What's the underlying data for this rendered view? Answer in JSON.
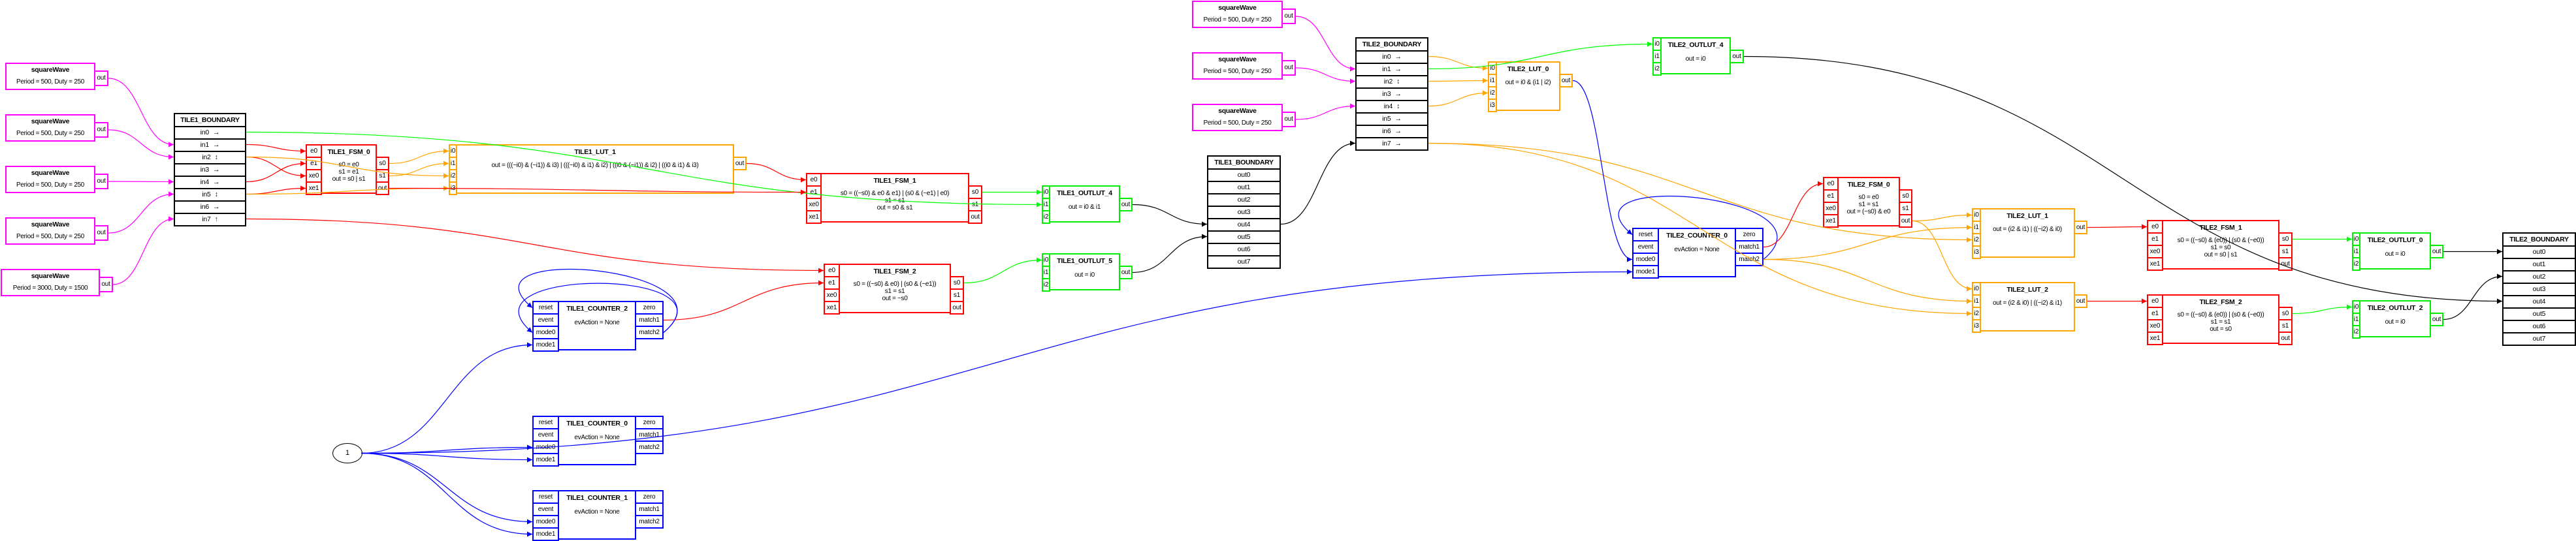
{
  "colors": {
    "source": "#ff00ff",
    "fsm": "#ff0000",
    "lut": "#ffa500",
    "counter": "#0000ff",
    "outlut": "#00ee00",
    "boundary": "#000000",
    "edge_magenta": "#ff00ff",
    "edge_red": "#ff0000",
    "edge_orange": "#ffa500",
    "edge_green": "#00ff00",
    "edge_blue": "#0000ff",
    "edge_black": "#000000"
  },
  "diagram": {
    "sources": [
      {
        "id": "t1w1",
        "title": "squareWave",
        "params": "Period = 500, Duty = 250",
        "port": "out"
      },
      {
        "id": "t1w2",
        "title": "squareWave",
        "params": "Period = 500, Duty = 250",
        "port": "out"
      },
      {
        "id": "t1w3",
        "title": "squareWave",
        "params": "Period = 500, Duty = 250",
        "port": "out"
      },
      {
        "id": "t1w4",
        "title": "squareWave",
        "params": "Period = 500, Duty = 250",
        "port": "out"
      },
      {
        "id": "t1w5",
        "title": "squareWave",
        "params": "Period = 3000, Duty = 1500",
        "port": "out"
      },
      {
        "id": "t2w1",
        "title": "squareWave",
        "params": "Period = 500, Duty = 250",
        "port": "out"
      },
      {
        "id": "t2w2",
        "title": "squareWave",
        "params": "Period = 500, Duty = 250",
        "port": "out"
      },
      {
        "id": "t2w3",
        "title": "squareWave",
        "params": "Period = 500, Duty = 250",
        "port": "out"
      }
    ],
    "boundaries": [
      {
        "id": "t1in",
        "title": "TILE1_BOUNDARY",
        "side": "input",
        "rows": [
          {
            "name": "in0",
            "dir": "→"
          },
          {
            "name": "in1",
            "dir": "→"
          },
          {
            "name": "in2",
            "dir": "↕"
          },
          {
            "name": "in3",
            "dir": "→"
          },
          {
            "name": "in4",
            "dir": "→"
          },
          {
            "name": "in5",
            "dir": "↕"
          },
          {
            "name": "in6",
            "dir": "→"
          },
          {
            "name": "in7",
            "dir": "↑"
          }
        ]
      },
      {
        "id": "t1out",
        "title": "TILE1_BOUNDARY",
        "side": "output",
        "rows": [
          {
            "name": "out0",
            "dir": ""
          },
          {
            "name": "out1",
            "dir": ""
          },
          {
            "name": "out2",
            "dir": ""
          },
          {
            "name": "out3",
            "dir": ""
          },
          {
            "name": "out4",
            "dir": ""
          },
          {
            "name": "out5",
            "dir": ""
          },
          {
            "name": "out6",
            "dir": ""
          },
          {
            "name": "out7",
            "dir": ""
          }
        ]
      },
      {
        "id": "t2in",
        "title": "TILE2_BOUNDARY",
        "side": "input",
        "rows": [
          {
            "name": "in0",
            "dir": "→"
          },
          {
            "name": "in1",
            "dir": "→"
          },
          {
            "name": "in2",
            "dir": "↕"
          },
          {
            "name": "in3",
            "dir": "→"
          },
          {
            "name": "in4",
            "dir": "↕"
          },
          {
            "name": "in5",
            "dir": "→"
          },
          {
            "name": "in6",
            "dir": "→"
          },
          {
            "name": "in7",
            "dir": "→"
          }
        ]
      },
      {
        "id": "t2out",
        "title": "TILE2_BOUNDARY",
        "side": "output",
        "rows": [
          {
            "name": "out0",
            "dir": ""
          },
          {
            "name": "out1",
            "dir": ""
          },
          {
            "name": "out2",
            "dir": ""
          },
          {
            "name": "out3",
            "dir": ""
          },
          {
            "name": "out4",
            "dir": ""
          },
          {
            "name": "out5",
            "dir": ""
          },
          {
            "name": "out6",
            "dir": ""
          },
          {
            "name": "out7",
            "dir": ""
          }
        ]
      }
    ],
    "blocks": [
      {
        "id": "T1_FSM_0",
        "kind": "fsm",
        "title": "TILE1_FSM_0",
        "lines": [
          "s0 = e0",
          "s1 = e1",
          "out = s0 | s1"
        ],
        "inputs": [
          "e0",
          "e1",
          "xe0",
          "xe1"
        ],
        "outputs": [
          "s0",
          "s1",
          "out"
        ]
      },
      {
        "id": "T1_LUT_1",
        "kind": "lut",
        "title": "TILE1_LUT_1",
        "lines": [
          "out = (((~i0) & (~i1)) & i3) | (((~i0) & i1) & i2) | ((i0 & (~i1)) & i2) | ((i0 & i1) & i3)"
        ],
        "inputs": [
          "i0",
          "i1",
          "i2",
          "i3"
        ],
        "outputs": [
          "out"
        ]
      },
      {
        "id": "T1_FSM_1",
        "kind": "fsm",
        "title": "TILE1_FSM_1",
        "lines": [
          "s0 = ((~s0) & e0 & e1) | (s0 & (~e1) | e0)",
          "s1 = s1",
          "out = s0 & s1"
        ],
        "inputs": [
          "e0",
          "e1",
          "xe0",
          "xe1"
        ],
        "outputs": [
          "s0",
          "s1",
          "out"
        ]
      },
      {
        "id": "T1_FSM_2",
        "kind": "fsm",
        "title": "TILE1_FSM_2",
        "lines": [
          "s0 = ((~s0) & e0) | (s0 & (~e1))",
          "s1 = s1",
          "out = ~s0"
        ],
        "inputs": [
          "e0",
          "e1",
          "xe0",
          "xe1"
        ],
        "outputs": [
          "s0",
          "s1",
          "out"
        ]
      },
      {
        "id": "T1_COUNTER_2",
        "kind": "counter",
        "title": "TILE1_COUNTER_2",
        "lines": [
          "evAction = None"
        ],
        "inputs": [
          "reset",
          "event",
          "mode0",
          "mode1"
        ],
        "outputs": [
          "zero",
          "match1",
          "match2"
        ]
      },
      {
        "id": "T1_COUNTER_0",
        "kind": "counter",
        "title": "TILE1_COUNTER_0",
        "lines": [
          "evAction = None"
        ],
        "inputs": [
          "reset",
          "event",
          "mode0",
          "mode1"
        ],
        "outputs": [
          "zero",
          "match1",
          "match2"
        ]
      },
      {
        "id": "T1_COUNTER_1",
        "kind": "counter",
        "title": "TILE1_COUNTER_1",
        "lines": [
          "evAction = None"
        ],
        "inputs": [
          "reset",
          "event",
          "mode0",
          "mode1"
        ],
        "outputs": [
          "zero",
          "match1",
          "match2"
        ]
      },
      {
        "id": "T1_OUTLUT_4",
        "kind": "outlut",
        "title": "TILE1_OUTLUT_4",
        "lines": [
          "out = i0 & i1"
        ],
        "inputs": [
          "i0",
          "i1",
          "i2"
        ],
        "outputs": [
          "out"
        ]
      },
      {
        "id": "T1_OUTLUT_5",
        "kind": "outlut",
        "title": "TILE1_OUTLUT_5",
        "lines": [
          "out = i0"
        ],
        "inputs": [
          "i0",
          "i1",
          "i2"
        ],
        "outputs": [
          "out"
        ]
      },
      {
        "id": "T2_LUT_0",
        "kind": "lut",
        "title": "TILE2_LUT_0",
        "lines": [
          "out = i0 & (i1 | i2)"
        ],
        "inputs": [
          "i0",
          "i1",
          "i2",
          "i3"
        ],
        "outputs": [
          "out"
        ]
      },
      {
        "id": "T2_OUTLUT_4",
        "kind": "outlut",
        "title": "TILE2_OUTLUT_4",
        "lines": [
          "out = i0"
        ],
        "inputs": [
          "i0",
          "i1",
          "i2"
        ],
        "outputs": [
          "out"
        ]
      },
      {
        "id": "T2_COUNTER_0",
        "kind": "counter",
        "title": "TILE2_COUNTER_0",
        "lines": [
          "evAction = None"
        ],
        "inputs": [
          "reset",
          "event",
          "mode0",
          "mode1"
        ],
        "outputs": [
          "zero",
          "match1",
          "match2"
        ]
      },
      {
        "id": "T2_FSM_0",
        "kind": "fsm",
        "title": "TILE2_FSM_0",
        "lines": [
          "s0 = e0",
          "s1 = s1",
          "out = (~s0) & e0"
        ],
        "inputs": [
          "e0",
          "e1",
          "xe0",
          "xe1"
        ],
        "outputs": [
          "s0",
          "s1",
          "out"
        ]
      },
      {
        "id": "T2_LUT_1",
        "kind": "lut",
        "title": "TILE2_LUT_1",
        "lines": [
          "out = (i2 & i1) | ((~i2) & i0)"
        ],
        "inputs": [
          "i0",
          "i1",
          "i2",
          "i3"
        ],
        "outputs": [
          "out"
        ]
      },
      {
        "id": "T2_LUT_2",
        "kind": "lut",
        "title": "TILE2_LUT_2",
        "lines": [
          "out = (i2 & i0) | ((~i2) & i1)"
        ],
        "inputs": [
          "i0",
          "i1",
          "i2",
          "i3"
        ],
        "outputs": [
          "out"
        ]
      },
      {
        "id": "T2_FSM_1",
        "kind": "fsm",
        "title": "TILE2_FSM_1",
        "lines": [
          "s0 = ((~s0) & (e0)) | (s0 & (~e0))",
          "s1 = s0",
          "out = s0 | s1"
        ],
        "inputs": [
          "e0",
          "e1",
          "xe0",
          "xe1"
        ],
        "outputs": [
          "s0",
          "s1",
          "out"
        ]
      },
      {
        "id": "T2_FSM_2",
        "kind": "fsm",
        "title": "TILE2_FSM_2",
        "lines": [
          "s0 = ((~s0) & (e0)) | (s0 & (~e0))",
          "s1 = s1",
          "out = s0"
        ],
        "inputs": [
          "e0",
          "e1",
          "xe0",
          "xe1"
        ],
        "outputs": [
          "s0",
          "s1",
          "out"
        ]
      },
      {
        "id": "T2_OUTLUT_0",
        "kind": "outlut",
        "title": "TILE2_OUTLUT_0",
        "lines": [
          "out = i0"
        ],
        "inputs": [
          "i0",
          "i1",
          "i2"
        ],
        "outputs": [
          "out"
        ]
      },
      {
        "id": "T2_OUTLUT_2",
        "kind": "outlut",
        "title": "TILE2_OUTLUT_2",
        "lines": [
          "out = i0"
        ],
        "inputs": [
          "i0",
          "i1",
          "i2"
        ],
        "outputs": [
          "out"
        ]
      }
    ],
    "constants": [
      {
        "id": "c1",
        "label": "1"
      }
    ],
    "edges": [
      {
        "from": "t1w1.out",
        "to": "t1in.in1",
        "color": "edge_magenta"
      },
      {
        "from": "t1w2.out",
        "to": "t1in.in2",
        "color": "edge_magenta"
      },
      {
        "from": "t1w3.out",
        "to": "t1in.in4",
        "color": "edge_magenta"
      },
      {
        "from": "t1w4.out",
        "to": "t1in.in5",
        "color": "edge_magenta"
      },
      {
        "from": "t1w5.out",
        "to": "t1in.in7",
        "color": "edge_magenta"
      },
      {
        "from": "t1in.in0",
        "to": "T1_OUTLUT_4.i1",
        "color": "edge_green"
      },
      {
        "from": "t1in.in1",
        "to": "T1_FSM_0.e0",
        "color": "edge_red"
      },
      {
        "from": "t1in.in2",
        "to": "T1_FSM_0.xe0",
        "color": "edge_red"
      },
      {
        "from": "t1in.in2",
        "to": "T1_LUT_1.i2",
        "color": "edge_orange"
      },
      {
        "from": "t1in.in4",
        "to": "T1_FSM_0.e1",
        "color": "edge_red"
      },
      {
        "from": "t1in.in5",
        "to": "T1_FSM_0.xe1",
        "color": "edge_red"
      },
      {
        "from": "t1in.in5",
        "to": "T1_LUT_1.i3",
        "color": "edge_orange"
      },
      {
        "from": "t1in.in7",
        "to": "T1_FSM_2.e0",
        "color": "edge_red"
      },
      {
        "from": "T1_FSM_0.s0",
        "to": "T1_LUT_1.i0",
        "color": "edge_orange"
      },
      {
        "from": "T1_FSM_0.s1",
        "to": "T1_LUT_1.i1",
        "color": "edge_orange"
      },
      {
        "from": "T1_FSM_0.out",
        "to": "T1_FSM_1.e1",
        "color": "edge_red"
      },
      {
        "from": "T1_LUT_1.out",
        "to": "T1_FSM_1.e0",
        "color": "edge_red"
      },
      {
        "from": "T1_FSM_1.s0",
        "to": "T1_OUTLUT_4.i0",
        "color": "edge_green"
      },
      {
        "from": "T1_COUNTER_2.match1",
        "to": "T1_FSM_2.e1",
        "color": "edge_red"
      },
      {
        "from": "T1_COUNTER_2.match2",
        "to": "T1_COUNTER_2.reset",
        "color": "edge_blue"
      },
      {
        "from": "T1_COUNTER_2.match2",
        "to": "T1_COUNTER_2.mode0",
        "color": "edge_blue"
      },
      {
        "from": "T1_FSM_2.s0",
        "to": "T1_OUTLUT_5.i0",
        "color": "edge_green"
      },
      {
        "from": "c1",
        "to": "T1_COUNTER_2.mode1",
        "color": "edge_blue"
      },
      {
        "from": "c1",
        "to": "T1_COUNTER_0.mode0",
        "color": "edge_blue"
      },
      {
        "from": "c1",
        "to": "T1_COUNTER_0.mode1",
        "color": "edge_blue"
      },
      {
        "from": "c1",
        "to": "T1_COUNTER_1.mode0",
        "color": "edge_blue"
      },
      {
        "from": "c1",
        "to": "T1_COUNTER_1.mode1",
        "color": "edge_blue"
      },
      {
        "from": "c1",
        "to": "T2_COUNTER_0.mode1",
        "color": "edge_blue"
      },
      {
        "from": "T1_OUTLUT_4.out",
        "to": "t1out.out4",
        "color": "edge_black"
      },
      {
        "from": "T1_OUTLUT_5.out",
        "to": "t1out.out5",
        "color": "edge_black"
      },
      {
        "from": "t1out.out4",
        "to": "t2in.in7",
        "color": "edge_black"
      },
      {
        "from": "t2w1.out",
        "to": "t2in.in1",
        "color": "edge_magenta"
      },
      {
        "from": "t2w2.out",
        "to": "t2in.in2",
        "color": "edge_magenta"
      },
      {
        "from": "t2w3.out",
        "to": "t2in.in4",
        "color": "edge_magenta"
      },
      {
        "from": "t2in.in0",
        "to": "T2_LUT_0.i0",
        "color": "edge_orange"
      },
      {
        "from": "t2in.in2",
        "to": "T2_LUT_0.i1",
        "color": "edge_orange"
      },
      {
        "from": "t2in.in4",
        "to": "T2_LUT_0.i2",
        "color": "edge_orange"
      },
      {
        "from": "t2in.in1",
        "to": "T2_OUTLUT_4.i0",
        "color": "edge_green"
      },
      {
        "from": "t2in.in7",
        "to": "T2_LUT_1.i2",
        "color": "edge_orange"
      },
      {
        "from": "t2in.in7",
        "to": "T2_LUT_2.i2",
        "color": "edge_orange"
      },
      {
        "from": "T2_LUT_0.out",
        "to": "T2_COUNTER_0.mode0",
        "color": "edge_blue"
      },
      {
        "from": "T2_COUNTER_0.match2",
        "to": "T2_COUNTER_0.reset",
        "color": "edge_blue"
      },
      {
        "from": "T2_COUNTER_0.match1",
        "to": "T2_FSM_0.e0",
        "color": "edge_red"
      },
      {
        "from": "T2_COUNTER_0.match2",
        "to": "T2_LUT_1.i1",
        "color": "edge_orange"
      },
      {
        "from": "T2_COUNTER_0.match2",
        "to": "T2_LUT_2.i1",
        "color": "edge_orange"
      },
      {
        "from": "T2_FSM_0.out",
        "to": "T2_LUT_1.i0",
        "color": "edge_orange"
      },
      {
        "from": "T2_FSM_0.out",
        "to": "T2_LUT_2.i0",
        "color": "edge_orange"
      },
      {
        "from": "T2_LUT_1.out",
        "to": "T2_FSM_1.e0",
        "color": "edge_red"
      },
      {
        "from": "T2_LUT_2.out",
        "to": "T2_FSM_2.e0",
        "color": "edge_red"
      },
      {
        "from": "T2_FSM_1.s0",
        "to": "T2_OUTLUT_0.i0",
        "color": "edge_green"
      },
      {
        "from": "T2_FSM_2.s0",
        "to": "T2_OUTLUT_2.i0",
        "color": "edge_green"
      },
      {
        "from": "T2_OUTLUT_0.out",
        "to": "t2out.out0",
        "color": "edge_black"
      },
      {
        "from": "T2_OUTLUT_2.out",
        "to": "t2out.out2",
        "color": "edge_black"
      },
      {
        "from": "T2_OUTLUT_4.out",
        "to": "t2out.out4",
        "color": "edge_black"
      }
    ]
  }
}
